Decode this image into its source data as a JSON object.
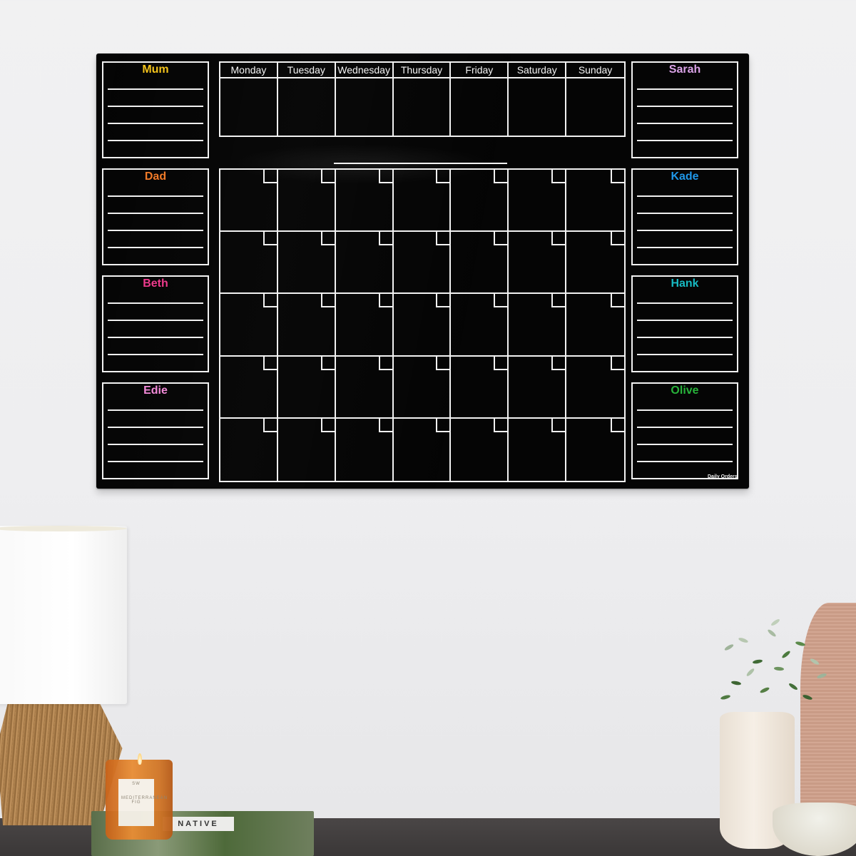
{
  "scene": {
    "description": "Black acrylic weekly and monthly family planner mounted on a white wall above a sideboard",
    "brand_text": "Daily Orders"
  },
  "planner": {
    "weekdays": [
      "Monday",
      "Tuesday",
      "Wednesday",
      "Thursday",
      "Friday",
      "Saturday",
      "Sunday"
    ],
    "month_grid": {
      "rows": 5,
      "columns": 7
    },
    "lines_per_person": 4,
    "people_left": [
      {
        "name": "Mum",
        "color": "#f2c21b"
      },
      {
        "name": "Dad",
        "color": "#f07a28"
      },
      {
        "name": "Beth",
        "color": "#ee3a8c"
      },
      {
        "name": "Edie",
        "color": "#f28ad8"
      }
    ],
    "people_right": [
      {
        "name": "Sarah",
        "color": "#d9a2e6"
      },
      {
        "name": "Kade",
        "color": "#1f97e8"
      },
      {
        "name": "Hank",
        "color": "#17b9c2"
      },
      {
        "name": "Olive",
        "color": "#27b23a"
      }
    ],
    "board_color": "#050505",
    "line_color": "#f2f2f2"
  },
  "objects": {
    "lamp": "Woven rope table lamp with white drum shade",
    "candle": {
      "label": "MEDITERRANEAN FIG",
      "monogram": "SW"
    },
    "book": {
      "title": "NATIVE"
    },
    "vases": [
      "Cream ceramic vase with greenery",
      "Ribbed terracotta vase",
      "Speckled ceramic bowl"
    ]
  }
}
